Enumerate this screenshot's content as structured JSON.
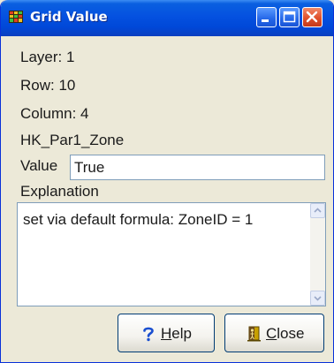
{
  "window": {
    "title": "Grid Value",
    "controls": {
      "minimize": "minimize",
      "maximize": "maximize",
      "close": "close"
    }
  },
  "info": {
    "layer": "Layer: 1",
    "row": "Row: 10",
    "column": "Column: 4",
    "parameter": "HK_Par1_Zone"
  },
  "value": {
    "label": "Value",
    "current": "True"
  },
  "explanation": {
    "label": "Explanation",
    "text": "set via default formula: ZoneID = 1"
  },
  "buttons": {
    "help": {
      "mnemonic": "H",
      "rest": "elp"
    },
    "close": {
      "mnemonic": "C",
      "rest": "lose"
    }
  },
  "icons": {
    "title": "grid-app-icon",
    "help": "question-mark-icon",
    "close": "door-exit-icon"
  },
  "colors": {
    "titlebar": "#0551e0",
    "window_bg": "#ece9d8",
    "close_button": "#e0502a",
    "help_icon": "#1a4fd0"
  }
}
